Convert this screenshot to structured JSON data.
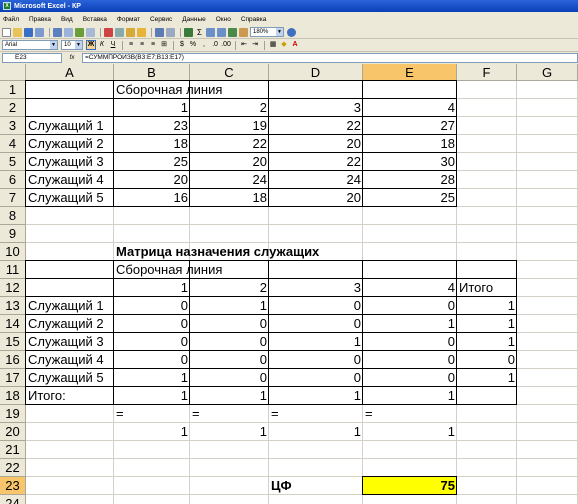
{
  "window": {
    "title": "Microsoft Excel - КР"
  },
  "menu": [
    "Файл",
    "Правка",
    "Вид",
    "Вставка",
    "Формат",
    "Сервис",
    "Данные",
    "Окно",
    "Справка"
  ],
  "toolbar": {
    "zoom": "180%",
    "font_name": "Arial",
    "font_size": "10"
  },
  "formula_bar": {
    "name_box": "E23",
    "fx": "fx",
    "formula": "=СУММПРОИЗВ(B3:E7;B13:E17)"
  },
  "columns": [
    "A",
    "B",
    "C",
    "D",
    "E",
    "F",
    "G"
  ],
  "rows": [
    "1",
    "2",
    "3",
    "4",
    "5",
    "6",
    "7",
    "8",
    "9",
    "10",
    "11",
    "12",
    "13",
    "14",
    "15",
    "16",
    "17",
    "18",
    "19",
    "20",
    "21",
    "22",
    "23",
    "24"
  ],
  "selected_cell": "E23",
  "colors": {
    "highlight": "#ffff00",
    "header_selected": "#f9c56a",
    "title_bar": "#0a3fb8"
  },
  "sheet": {
    "r1": {
      "B": "Сборочная линия"
    },
    "r2": {
      "B": "1",
      "C": "2",
      "D": "3",
      "E": "4"
    },
    "r3": {
      "A": "Служащий 1",
      "B": "23",
      "C": "19",
      "D": "22",
      "E": "27"
    },
    "r4": {
      "A": "Служащий 2",
      "B": "18",
      "C": "22",
      "D": "20",
      "E": "18"
    },
    "r5": {
      "A": "Служащий 3",
      "B": "25",
      "C": "20",
      "D": "22",
      "E": "30"
    },
    "r6": {
      "A": "Служащий 4",
      "B": "20",
      "C": "24",
      "D": "24",
      "E": "28"
    },
    "r7": {
      "A": "Служащий 5",
      "B": "16",
      "C": "18",
      "D": "20",
      "E": "25"
    },
    "r10": {
      "B": "Матрица назначения служащих"
    },
    "r11": {
      "B": "Сборочная линия"
    },
    "r12": {
      "B": "1",
      "C": "2",
      "D": "3",
      "E": "4",
      "F": "Итого"
    },
    "r13": {
      "A": "Служащий 1",
      "B": "0",
      "C": "1",
      "D": "0",
      "E": "0",
      "F": "1"
    },
    "r14": {
      "A": "Служащий 2",
      "B": "0",
      "C": "0",
      "D": "0",
      "E": "1",
      "F": "1"
    },
    "r15": {
      "A": "Служащий 3",
      "B": "0",
      "C": "0",
      "D": "1",
      "E": "0",
      "F": "1"
    },
    "r16": {
      "A": "Служащий 4",
      "B": "0",
      "C": "0",
      "D": "0",
      "E": "0",
      "F": "0"
    },
    "r17": {
      "A": "Служащий 5",
      "B": "1",
      "C": "0",
      "D": "0",
      "E": "0",
      "F": "1"
    },
    "r18": {
      "A": "Итого:",
      "B": "1",
      "C": "1",
      "D": "1",
      "E": "1"
    },
    "r19": {
      "B": "=",
      "C": "=",
      "D": "=",
      "E": "="
    },
    "r20": {
      "B": "1",
      "C": "1",
      "D": "1",
      "E": "1"
    },
    "r23": {
      "D": "ЦФ",
      "E": "75"
    }
  }
}
